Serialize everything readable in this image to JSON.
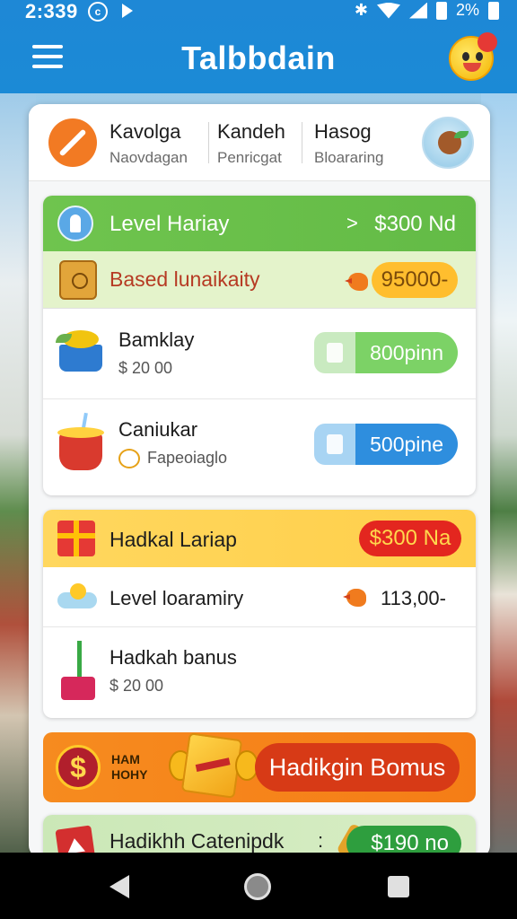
{
  "status_bar": {
    "time": "2:339",
    "battery": "2%"
  },
  "app": {
    "title": "Talbbdain"
  },
  "tabs": [
    {
      "title": "Kavolga",
      "subtitle": "Naovdagan"
    },
    {
      "title": "Kandeh",
      "subtitle": "Penricgat"
    },
    {
      "title": "Hasog",
      "subtitle": "Bloararing"
    }
  ],
  "card1": {
    "header_title": "Level Hariay",
    "header_separator": ">",
    "header_value": "$300 Nd",
    "sub_title": "Based lunaikaity",
    "sub_badge": "95000-",
    "items": [
      {
        "title": "Bamklay",
        "subtitle": "$ 20 00",
        "action": "800pinn"
      },
      {
        "title": "Caniukar",
        "subtitle": "Fapeoiaglo",
        "action": "500pine"
      }
    ]
  },
  "card2": {
    "header_title": "Hadkal Lariap",
    "header_value": "$300 Na",
    "row1_title": "Level loaramiry",
    "row1_value": "113,00-",
    "row2_title": "Hadkah banus",
    "row2_subtitle": "$ 20 00"
  },
  "banner": {
    "small_line1": "HAM",
    "small_line2": "HOHY",
    "button": "Hadikgin Bomus"
  },
  "card3": {
    "title": "Hadikhh Catenipdk",
    "separator": ":",
    "value": "$190 no"
  },
  "colors": {
    "appbar": "#1e88d6",
    "green_header": "#6fc44e",
    "yellow_header": "#ffd75e",
    "orange_banner": "#f68b1f",
    "red_badge": "#e3261f"
  }
}
